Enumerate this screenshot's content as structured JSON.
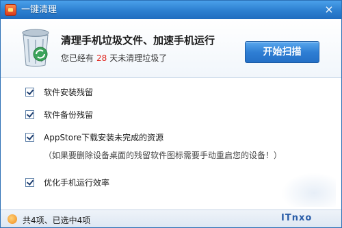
{
  "window": {
    "title": "一键清理",
    "close_glyph": "×"
  },
  "header": {
    "headline": "清理手机垃圾文件、加速手机运行",
    "sub_prefix": "您已经有",
    "days": "28",
    "sub_suffix": "天未清理垃圾了",
    "scan_button": "开始扫描"
  },
  "options": [
    {
      "label": "软件安装残留",
      "checked": true
    },
    {
      "label": "软件备份残留",
      "checked": true
    },
    {
      "label": "AppStore下载安装未完成的资源",
      "checked": true
    },
    {
      "label": "优化手机运行效率",
      "checked": true
    }
  ],
  "note": "（如果要删除设备桌面的残留软件图标需要手动重启您的设备！）",
  "status": {
    "text": "共4项、已选中4项"
  },
  "logo_text": "ITnxo",
  "colors": {
    "accent": "#2c7fd0",
    "days_highlight": "#e0251d"
  }
}
